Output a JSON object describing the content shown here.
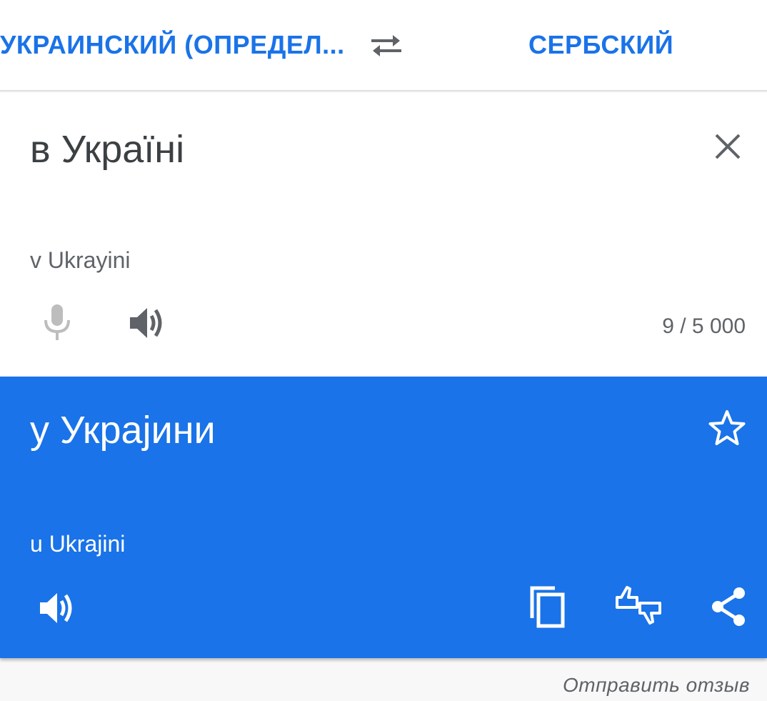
{
  "language_bar": {
    "source_language": "УКРАИНСКИЙ (ОПРЕДЕЛ...",
    "target_language": "СЕРБСКИЙ",
    "swap_icon": "swap-arrows-icon"
  },
  "input": {
    "text": "в Україні",
    "transliteration": "v Ukrayini",
    "char_count": "9 / 5 000",
    "clear_icon": "close-icon",
    "mic_icon": "microphone-icon",
    "speaker_icon": "speaker-icon"
  },
  "result": {
    "text": "у Украјини",
    "transliteration": "u Ukrajini",
    "star_icon": "star-outline-icon",
    "speaker_icon": "speaker-icon",
    "copy_icon": "copy-icon",
    "rate_icon": "thumbs-up-down-icon",
    "share_icon": "share-icon"
  },
  "footer": {
    "feedback_label": "Отправить отзыв"
  },
  "colors": {
    "accent": "#1a73e8",
    "text_primary": "#3c4043",
    "text_secondary": "#5f6368",
    "mic_disabled": "#bdbdbd"
  }
}
